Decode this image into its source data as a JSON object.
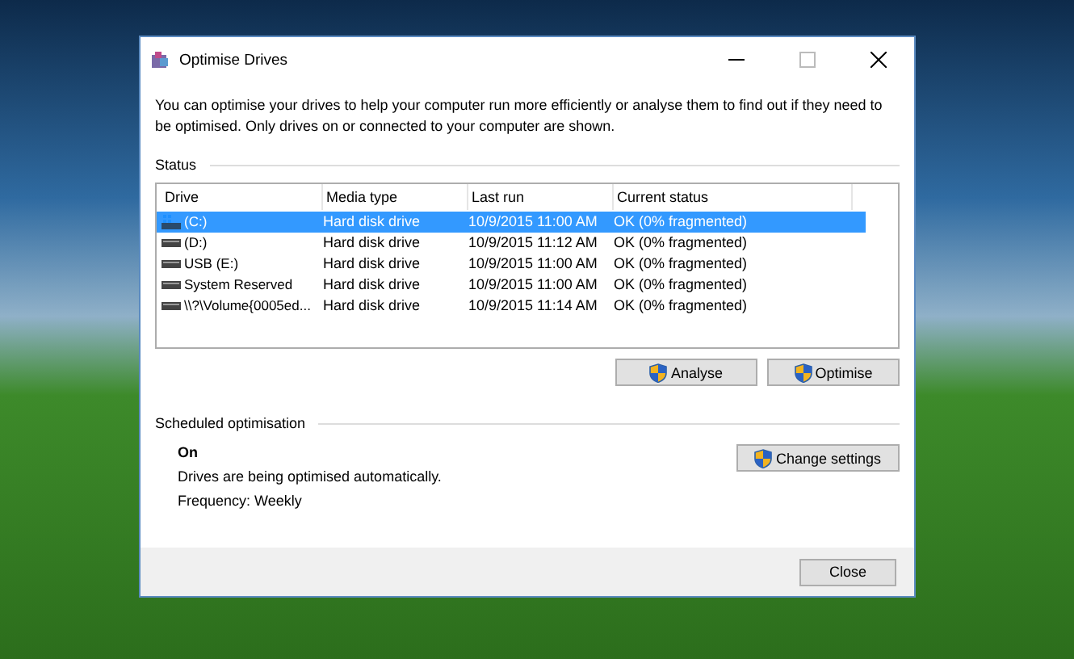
{
  "window": {
    "title": "Optimise Drives"
  },
  "description": "You can optimise your drives to help your computer run more efficiently or analyse them to find out if they need to be optimised. Only drives on or connected to your computer are shown.",
  "status": {
    "heading": "Status",
    "table": {
      "columns": [
        "Drive",
        "Media type",
        "Last run",
        "Current status"
      ],
      "rows": [
        {
          "kind": "system",
          "drive": "(C:)",
          "media_type": "Hard disk drive",
          "last_run": "10/9/2015 11:00 AM",
          "current_status": "OK (0% fragmented)",
          "selected": true
        },
        {
          "kind": "disk",
          "drive": "(D:)",
          "media_type": "Hard disk drive",
          "last_run": "10/9/2015 11:12 AM",
          "current_status": "OK (0% fragmented)",
          "selected": false
        },
        {
          "kind": "disk",
          "drive": "USB (E:)",
          "media_type": "Hard disk drive",
          "last_run": "10/9/2015 11:00 AM",
          "current_status": "OK (0% fragmented)",
          "selected": false
        },
        {
          "kind": "disk",
          "drive": "System Reserved",
          "media_type": "Hard disk drive",
          "last_run": "10/9/2015 11:00 AM",
          "current_status": "OK (0% fragmented)",
          "selected": false
        },
        {
          "kind": "disk",
          "drive": "\\\\?\\Volume{0005ed...",
          "media_type": "Hard disk drive",
          "last_run": "10/9/2015 11:14 AM",
          "current_status": "OK (0% fragmented)",
          "selected": false
        }
      ]
    },
    "buttons": [
      "Analyse",
      "Optimise"
    ]
  },
  "scheduled": {
    "heading": "Scheduled optimisation",
    "state": "On",
    "detail": "Drives are being optimised automatically.",
    "frequency": "Frequency: Weekly",
    "button": "Change settings"
  },
  "footer": {
    "button": "Close"
  }
}
